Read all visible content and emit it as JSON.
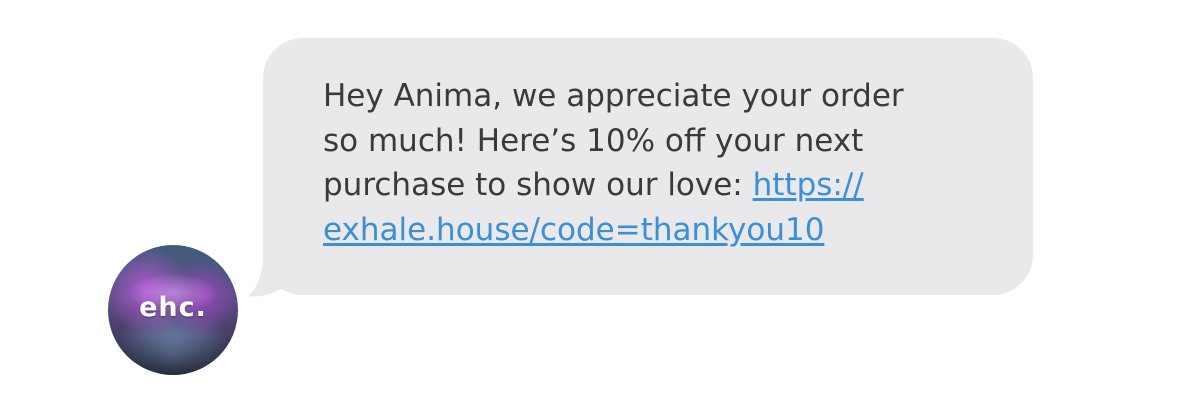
{
  "conversation": {
    "sender": {
      "avatar_label": "ehc."
    },
    "message": {
      "text_line_1": "Hey Anima, we appreciate your order",
      "text_line_2": "so much! Here’s 10% off your next",
      "text_line_3": "purchase to show our love: ",
      "link_part_1": "https://",
      "link_part_2": "exhale.house/code=thankyou10",
      "link_href": "https://exhale.house/code=thankyou10"
    },
    "colors": {
      "bubble": "#e9e9eb",
      "text": "#3a3a3c",
      "link": "#3a8fd6"
    }
  }
}
